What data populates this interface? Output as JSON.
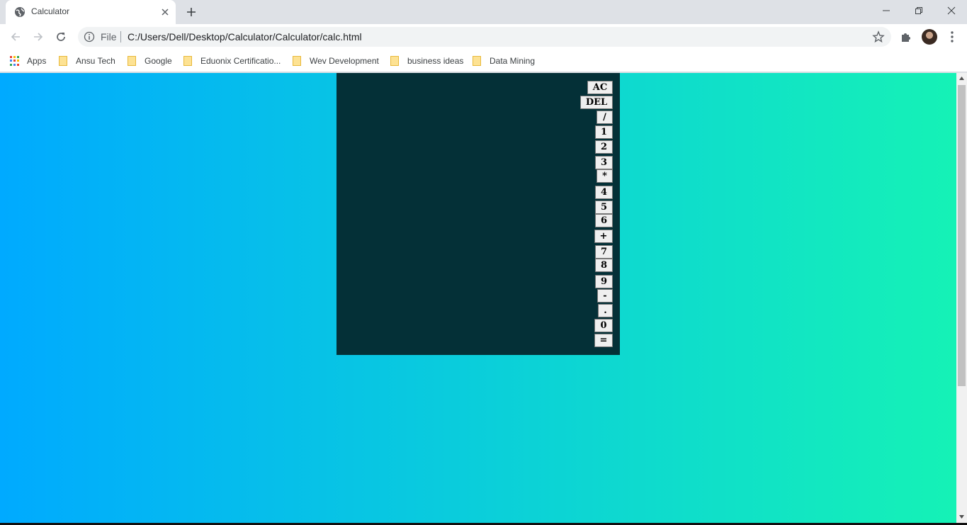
{
  "browser": {
    "tab_title": "Calculator",
    "address_scheme_label": "File",
    "address_url": "C:/Users/Dell/Desktop/Calculator/Calculator/calc.html"
  },
  "bookmarks": [
    {
      "label": "Apps",
      "icon": "apps-grid-icon"
    },
    {
      "label": "Ansu Tech",
      "icon": "folder-icon"
    },
    {
      "label": "Google",
      "icon": "folder-icon"
    },
    {
      "label": "Eduonix Certificatio...",
      "icon": "folder-icon"
    },
    {
      "label": "Wev Development",
      "icon": "folder-icon"
    },
    {
      "label": "business ideas",
      "icon": "folder-icon"
    },
    {
      "label": "Data Mining",
      "icon": "folder-icon"
    }
  ],
  "calculator": {
    "keys": [
      "AC",
      "DEL",
      "/",
      "1",
      "2",
      "3",
      "*",
      "4",
      "5",
      "6",
      "+",
      "7",
      "8",
      "9",
      "-",
      ".",
      "0",
      "="
    ]
  },
  "colors": {
    "gradient_start": "#00aaff",
    "gradient_end": "#15f2b6",
    "calculator_bg": "#043037"
  }
}
